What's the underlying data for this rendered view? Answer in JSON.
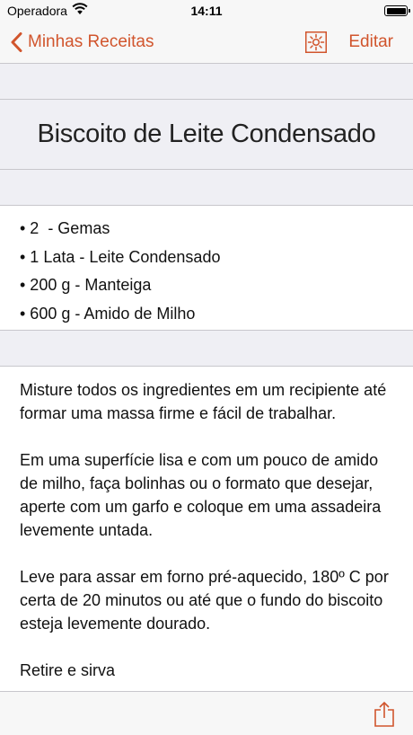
{
  "status_bar": {
    "carrier": "Operadora",
    "time": "14:11"
  },
  "nav": {
    "back_label": "Minhas Receitas",
    "edit_label": "Editar",
    "accent_color": "#d1552d",
    "icons": [
      "chevron-left-icon",
      "sun-icon"
    ]
  },
  "recipe": {
    "title": "Biscoito de Leite Condensado",
    "ingredients": [
      "• 2  - Gemas",
      "• 1 Lata - Leite Condensado",
      "• 200 g - Manteiga",
      "• 600 g - Amido de Milho"
    ],
    "instructions": [
      "Misture todos os ingredientes em um recipiente até formar uma massa firme e fácil de trabalhar.",
      "Em uma superfície lisa e com um pouco de amido de milho, faça bolinhas ou o formato que desejar, aperte com um garfo e coloque em uma assadeira levemente untada.",
      "Leve para assar em forno pré-aquecido, 180º C por certa de 20 minutos ou até que o fundo do biscoito esteja levemente dourado.",
      "Retire e sirva"
    ]
  },
  "toolbar": {
    "icons": [
      "share-icon"
    ]
  }
}
